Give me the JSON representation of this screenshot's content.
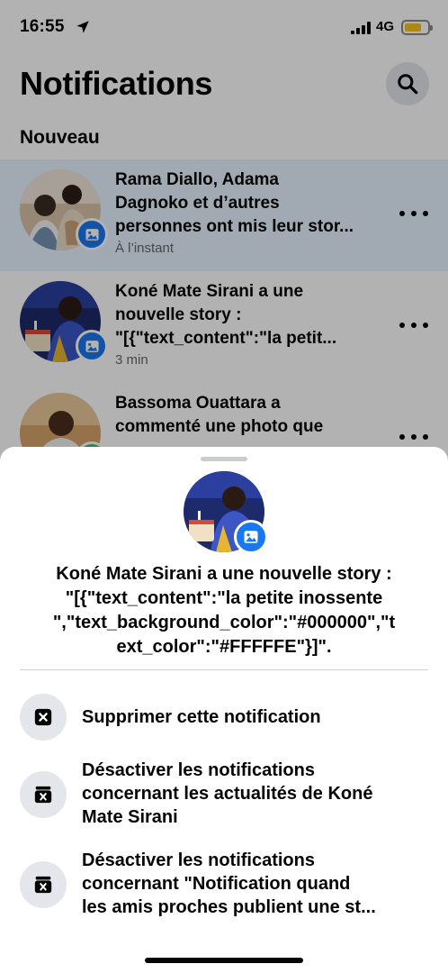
{
  "status_bar": {
    "time": "16:55",
    "network": "4G",
    "battery_color": "#f6c223",
    "icons": [
      "location-arrow-icon",
      "signal-icon",
      "battery-icon"
    ]
  },
  "header": {
    "title": "Notifications",
    "search_icon": "search-icon"
  },
  "section": {
    "title": "Nouveau"
  },
  "notifications": [
    {
      "lines": [
        "Rama Diallo, Adama",
        "Dagnoko et d’autres",
        "personnes ont mis leur stor..."
      ],
      "time": "À l’instant",
      "badge_icon": "photo-icon",
      "highlighted": true
    },
    {
      "lines": [
        "Koné Mate Sirani a une",
        "nouvelle story :",
        "\"[{\"text_content\":\"la petit..."
      ],
      "time": "3 min",
      "badge_icon": "photo-icon",
      "highlighted": false
    },
    {
      "lines": [
        "Bassoma Ouattara a",
        "commenté une photo que"
      ],
      "badge_icon": "comment-icon",
      "highlighted": false
    }
  ],
  "sheet": {
    "message_lines": [
      "Koné Mate Sirani a une nouvelle story :",
      "\"[{\"text_content\":\"la petite inossente",
      "\",\"text_background_color\":\"#000000\",\"t",
      "ext_color\":\"#FFFFFE\"}]\"."
    ],
    "badge_icon": "photo-icon",
    "actions": [
      {
        "icon": "close-box-icon",
        "lines": [
          "Supprimer cette notification"
        ]
      },
      {
        "icon": "mute-box-icon",
        "lines": [
          "Désactiver les notifications",
          "concernant les actualités de Koné",
          "Mate Sirani"
        ]
      },
      {
        "icon": "mute-box-icon",
        "lines": [
          "Désactiver les notifications",
          "concernant \"Notification quand",
          "les amis proches publient une st..."
        ]
      }
    ]
  },
  "colors": {
    "accent": "#1877f2",
    "highlight_bg": "#e7f3ff",
    "icon_bg": "#e4e6eb",
    "secondary_text": "#65676b"
  }
}
